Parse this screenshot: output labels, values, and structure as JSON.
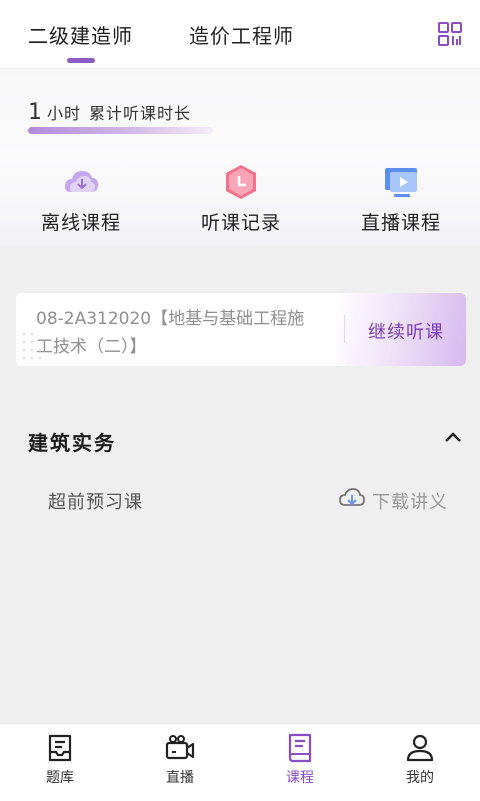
{
  "header": {
    "tabs": [
      {
        "label": "二级建造师",
        "active": true
      },
      {
        "label": "造价工程师",
        "active": false
      }
    ],
    "icon": "qr-grid-icon"
  },
  "study": {
    "hours_value": "1",
    "hours_unit": "小时",
    "hours_label": "累计听课时长"
  },
  "features": [
    {
      "label": "离线课程",
      "icon": "cloud-download-icon"
    },
    {
      "label": "听课记录",
      "icon": "clock-hexagon-icon"
    },
    {
      "label": "直播课程",
      "icon": "monitor-play-icon"
    }
  ],
  "continue_card": {
    "course_line1": "08-2A312020【地基与基础工程施",
    "course_line2": "工技术（二）】",
    "button": "继续听课"
  },
  "section": {
    "title": "建筑实务",
    "item_label": "超前预习课",
    "download_label": "下载讲义"
  },
  "bottom_nav": [
    {
      "label": "题库",
      "icon": "inbox-icon",
      "active": false
    },
    {
      "label": "直播",
      "icon": "video-camera-icon",
      "active": false
    },
    {
      "label": "课程",
      "icon": "book-icon",
      "active": true
    },
    {
      "label": "我的",
      "icon": "user-icon",
      "active": false
    }
  ],
  "colors": {
    "accent": "#8b4cc4",
    "background": "#efefef"
  }
}
